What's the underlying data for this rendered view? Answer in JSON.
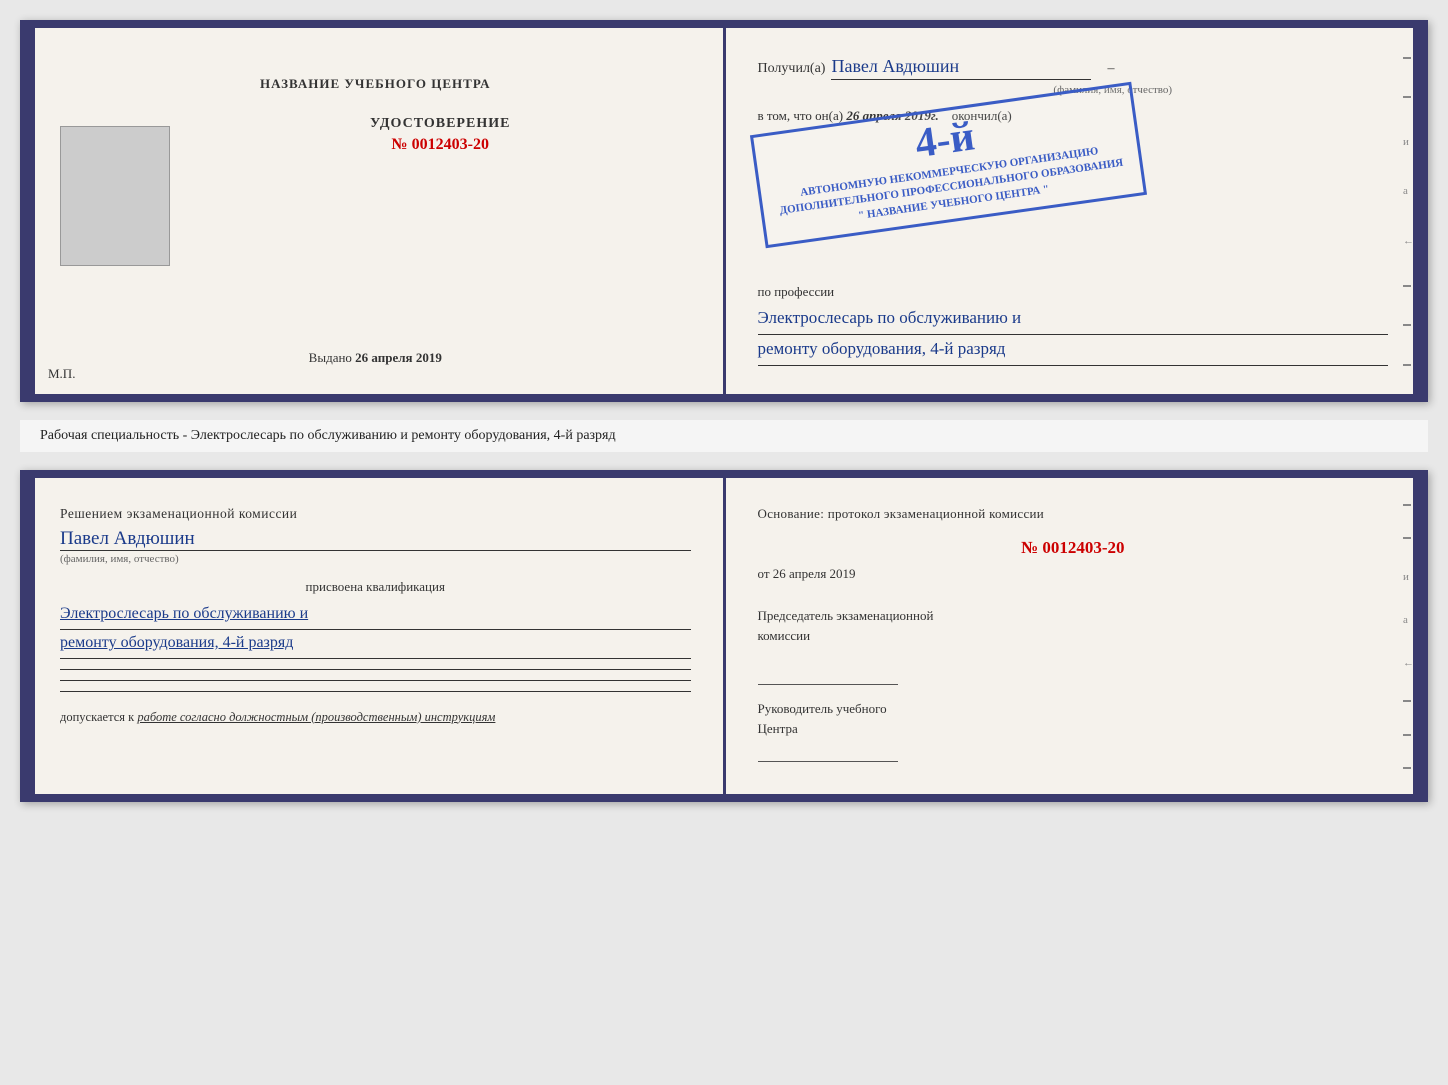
{
  "top_doc": {
    "left": {
      "center_title": "НАЗВАНИЕ УЧЕБНОГО ЦЕНТРА",
      "cert_title": "УДОСТОВЕРЕНИЕ",
      "cert_number": "№ 0012403-20",
      "issued_label": "Выдано",
      "issued_date": "26 апреля 2019",
      "mp_label": "М.П."
    },
    "right": {
      "received_label": "Получил(а)",
      "received_name": "Павел Авдюшин",
      "fio_hint": "(фамилия, имя, отчество)",
      "in_that_label": "в том, что он(а)",
      "completed_date": "26 апреля 2019г.",
      "completed_label": "окончил(а)",
      "org_line1": "АВТОНОМНУЮ НЕКОММЕРЧЕСКУЮ ОРГАНИЗАЦИЮ",
      "org_line2": "ДОПОЛНИТЕЛЬНОГО ПРОФЕССИОНАЛЬНОГО ОБРАЗОВАНИЯ",
      "org_name": "\" НАЗВАНИЕ УЧЕБНОГО ЦЕНТРА \"",
      "profession_label": "по профессии",
      "profession_line1": "Электрослесарь по обслуживанию и",
      "profession_line2": "ремонту оборудования, 4-й разряд"
    }
  },
  "middle": {
    "text": "Рабочая специальность - Электрослесарь по обслуживанию и ремонту оборудования, 4-й разряд"
  },
  "bottom_doc": {
    "left": {
      "decision_title": "Решением экзаменационной комиссии",
      "person_name": "Павел Авдюшин",
      "fio_hint": "(фамилия, имя, отчество)",
      "assigned_label": "присвоена квалификация",
      "qual_line1": "Электрослесарь по обслуживанию и",
      "qual_line2": "ремонту оборудования, 4-й разряд",
      "допускается_label": "допускается к",
      "допускается_text": "работе согласно должностным (производственным) инструкциям"
    },
    "right": {
      "basis_title": "Основание: протокол экзаменационной комиссии",
      "protocol_number": "№ 0012403-20",
      "from_label": "от",
      "from_date": "26 апреля 2019",
      "chairman_line1": "Председатель экзаменационной",
      "chairman_line2": "комиссии",
      "director_line1": "Руководитель учебного",
      "director_line2": "Центра"
    }
  },
  "stamp": {
    "line1": "4-й",
    "line2": "АВТОНОМНУЮ НЕКОММЕРЧЕСКУЮ ОРГАНИЗАЦИЮ",
    "line3": "ДОПОЛНИТЕЛЬНОГО ПРОФЕССИОНАЛЬНОГО ОБРАЗОВАНИЯ",
    "line4": "\" НАЗВАНИЕ УЧЕБНОГО ЦЕНТРА \""
  },
  "side_chars": [
    "–",
    "–",
    "и",
    "а",
    "←",
    "–",
    "–",
    "–"
  ]
}
